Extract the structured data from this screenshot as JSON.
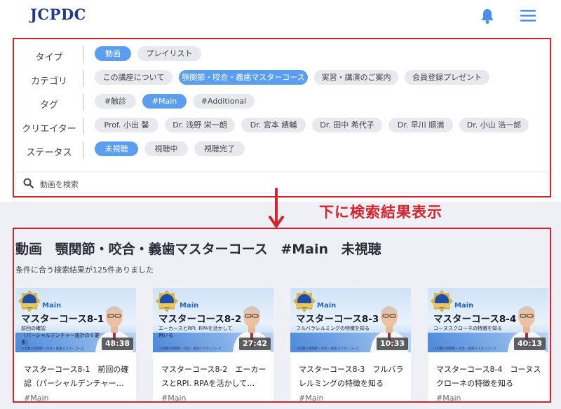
{
  "header": {
    "logo": "JCPDC"
  },
  "filters": {
    "type": {
      "label": "タイプ",
      "chips": [
        "動画",
        "プレイリスト"
      ]
    },
    "category": {
      "label": "カテゴリ",
      "chips": [
        "この講座について",
        "顎関節・咬合・義歯マスターコース",
        "実習・講演のご案内",
        "会員登録プレゼント"
      ]
    },
    "tag": {
      "label": "タグ",
      "chips": [
        "#触診",
        "#Main",
        "#Additional"
      ]
    },
    "creator": {
      "label": "クリエイター",
      "chips": [
        "Prof. 小出 馨",
        "Dr. 浅野 栄一朗",
        "Dr. 宮本 績輔",
        "Dr. 田中 希代子",
        "Dr. 早川 順満",
        "Dr. 小山 浩一郎"
      ]
    },
    "status": {
      "label": "ステータス",
      "chips": [
        "未視聴",
        "視聴中",
        "視聴完了"
      ]
    }
  },
  "search": {
    "placeholder": "動画を検索"
  },
  "annotation": {
    "text": "下に検索結果表示"
  },
  "results": {
    "title_parts": [
      "動画",
      "顎関節・咬合・義歯マスターコース",
      "#Main",
      "未視聴"
    ],
    "count_text": "条件に合う検索結果が125件ありました",
    "cards": [
      {
        "thumb_label": "Main",
        "thumb_title": "マスターコース8-1",
        "thumb_sub": "前回の確認\n（パーシャルデンチャー設計の６要素）",
        "thumb_foot": "小出馨の顎関節・咬合・義歯マスターコース",
        "duration": "48:38",
        "title": "マスターコース8-1　前回の確認（パーシャルデンチャー…",
        "tag": "#Main"
      },
      {
        "thumb_label": "Main",
        "thumb_title": "マスターコース8-2",
        "thumb_sub": "エーカースとRPI. RPAを活かして用いる",
        "thumb_foot": "小出馨の顎関節・咬合・義歯マスターコース",
        "duration": "27:42",
        "title": "マスターコース8-2　エーカースとRPI. RPAを活かして…",
        "tag": "#Main"
      },
      {
        "thumb_label": "Main",
        "thumb_title": "マスターコース8-3",
        "thumb_sub": "フルバラレルミングの特徴を知る",
        "thumb_foot": "小出馨の顎関節・咬合・義歯マスターコース",
        "duration": "10:33",
        "title": "マスターコース8-3　フルバラレルミングの特徴を知る",
        "tag": "#Main"
      },
      {
        "thumb_label": "Main",
        "thumb_title": "マスターコース8-4",
        "thumb_sub": "コーヌスクローネの特徴を知る",
        "thumb_foot": "小出馨の顎関節・咬合・義歯マスターコース",
        "duration": "40:13",
        "title": "マスターコース8-4　コーヌスクローネの特徴を知る",
        "tag": "#Main"
      }
    ]
  },
  "colors": {
    "accent": "#5b9ef0",
    "annotation_red": "#d8232a",
    "logo_navy": "#213a8a",
    "chip_inactive": "#e7e9ef"
  },
  "icons": {
    "bell": "bell-icon",
    "menu": "hamburger-menu-icon",
    "search": "search-icon",
    "arrow": "arrow-down-icon"
  }
}
